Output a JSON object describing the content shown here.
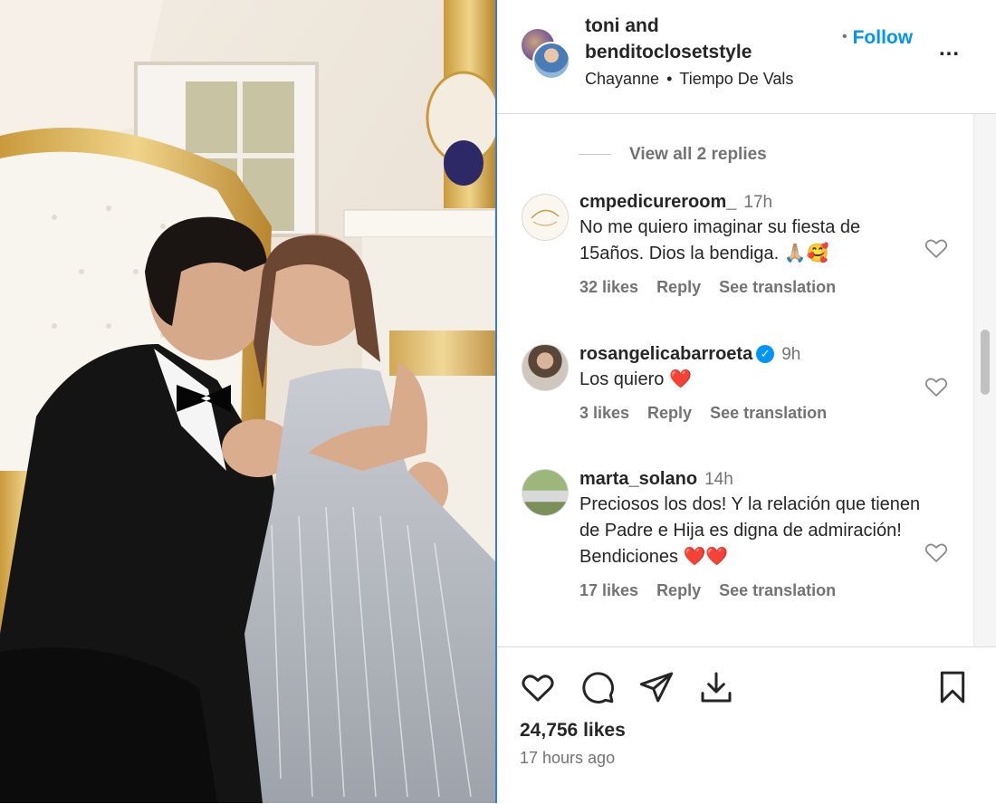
{
  "post": {
    "author_line1": "toni and",
    "author_line2": "benditoclosetstyle",
    "audio_artist": "Chayanne",
    "audio_title": "Tiempo De Vals",
    "follow_label": "Follow",
    "more_label": "..."
  },
  "replies": {
    "view_all_label": "View all 2 replies"
  },
  "comments": [
    {
      "user": "cmpedicureroom_",
      "time": "17h",
      "text": "No me quiero imaginar su fiesta de 15años. Dios la bendiga. 🙏🏼🥰",
      "likes": "32 likes",
      "reply": "Reply",
      "translate": "See translation"
    },
    {
      "user": "rosangelicabarroeta",
      "time": "9h",
      "text": "Los quiero ❤️",
      "likes": "3 likes",
      "reply": "Reply",
      "translate": "See translation",
      "verified": true
    },
    {
      "user": "marta_solano",
      "time": "14h",
      "text": "Preciosos los dos! Y la relación que tienen de Padre e Hija es digna de admiración! Bendiciones ❤️❤️",
      "likes": "17 likes",
      "reply": "Reply",
      "translate": "See translation"
    }
  ],
  "footer": {
    "likes": "24,756 likes",
    "posted": "17 hours ago"
  },
  "icons": [
    "heart-icon",
    "comment-icon",
    "share-icon",
    "download-icon",
    "bookmark-icon",
    "verified-icon"
  ],
  "colors": {
    "link_blue": "#0095f6",
    "muted": "#737373",
    "text": "#262626"
  }
}
